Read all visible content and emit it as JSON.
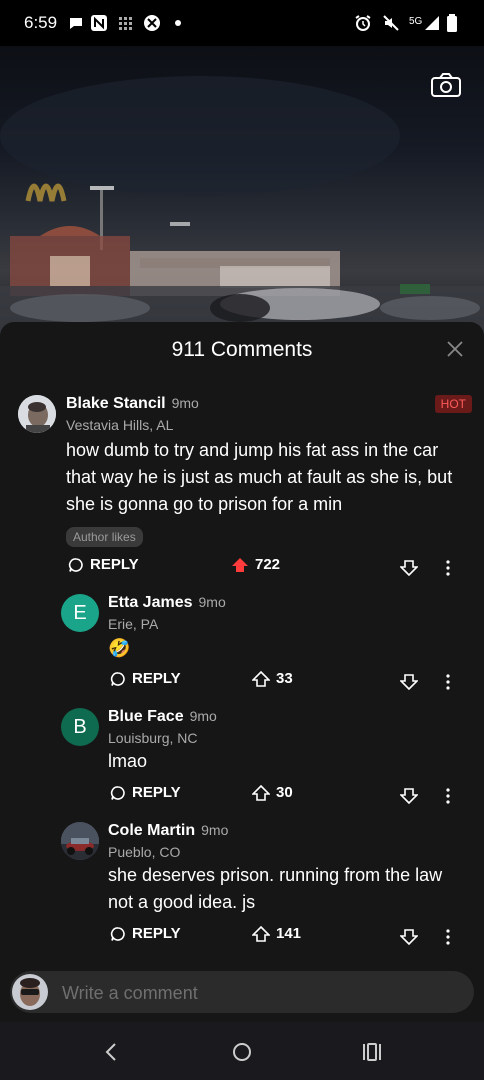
{
  "status": {
    "time": "6:59",
    "network": "5G"
  },
  "panel": {
    "title": "911 Comments",
    "close_icon": "close-icon"
  },
  "comments": [
    {
      "name": "Blake Stancil",
      "time": "9mo",
      "location": "Vestavia Hills, AL",
      "badge": "HOT",
      "text": "how dumb to try and jump his fat ass in the car that way he is just as much at fault as she is, but she is gonna go to prison for a min",
      "author_likes": "Author likes",
      "reply_label": "REPLY",
      "votes": "722",
      "upvoted": true
    },
    {
      "name": "Etta James",
      "time": "9mo",
      "location": "Erie, PA",
      "initial": "E",
      "avatar_color": "#1aa58a",
      "text": "🤣",
      "reply_label": "REPLY",
      "votes": "33"
    },
    {
      "name": "Blue Face",
      "time": "9mo",
      "location": "Louisburg, NC",
      "initial": "B",
      "avatar_color": "#0f6b4f",
      "text": "lmao",
      "reply_label": "REPLY",
      "votes": "30"
    },
    {
      "name": "Cole Martin",
      "time": "9mo",
      "location": "Pueblo, CO",
      "text": "she deserves prison. running from the law not a good idea. js",
      "reply_label": "REPLY",
      "votes": "141"
    }
  ],
  "composer": {
    "placeholder": "Write a comment"
  },
  "colors": {
    "upvote_active": "#ff3b3b",
    "panel_bg": "#161616",
    "hot_badge": "#6b1a1a"
  }
}
